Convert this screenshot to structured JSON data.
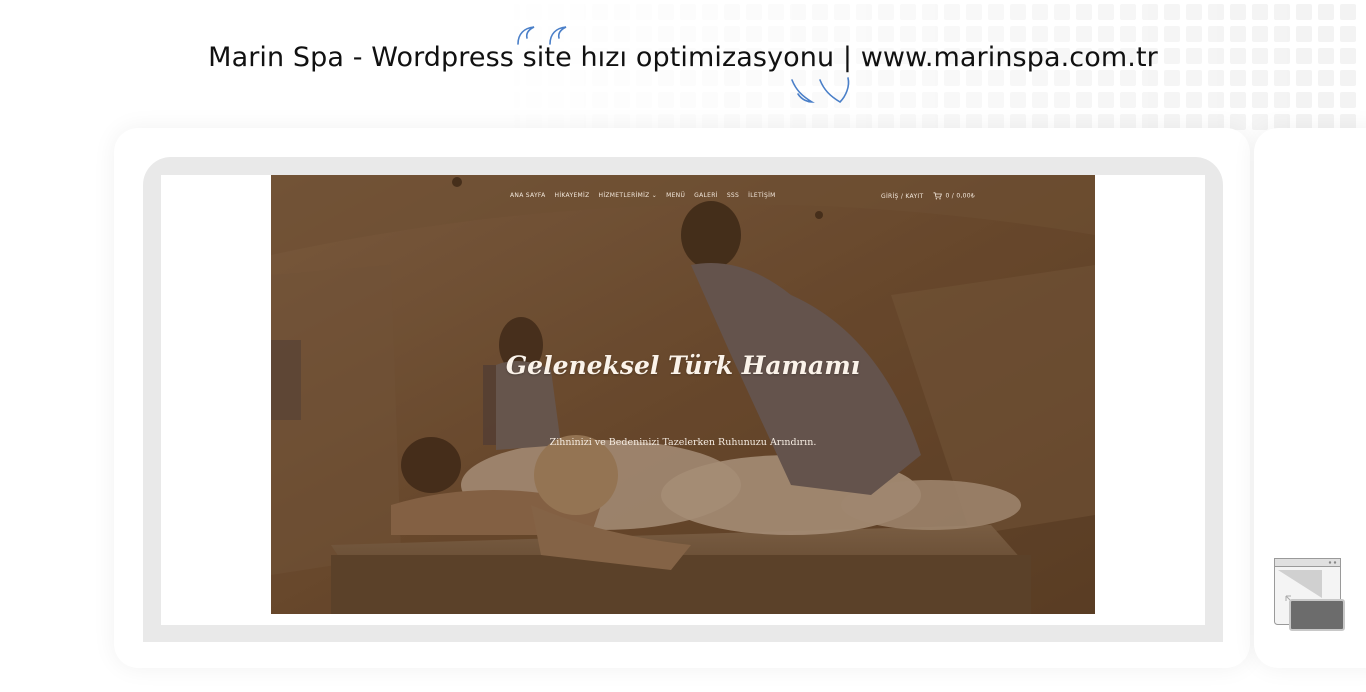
{
  "headline": {
    "text": "Marin Spa - Wordpress site hızı optimizasyonu | www.marinspa.com.tr"
  },
  "icons": {
    "quote_open": "quote-open-icon",
    "quote_close": "quote-close-icon",
    "cart": "cart-icon",
    "window_resize": "window-resize-icon"
  },
  "colors": {
    "quote_accent": "#4a7fc8",
    "hero_overlay": "#6e4e33",
    "nav_text": "#f3e8dc",
    "frame": "#e9e9e9"
  },
  "website": {
    "nav": {
      "items": [
        {
          "label": "ANA SAYFA"
        },
        {
          "label": "HİKAYEMİZ"
        },
        {
          "label": "HİZMETLERİMİZ ⌄"
        },
        {
          "label": "MENÜ"
        },
        {
          "label": "GALERİ"
        },
        {
          "label": "SSS"
        },
        {
          "label": "İLETİŞİM"
        }
      ],
      "login_label": "GİRİŞ / KAYIT",
      "cart_label": "0 / 0,00₺"
    },
    "hero": {
      "title": "Geleneksel Türk Hamamı",
      "subtitle": "Zihninizi ve Bedeninizi Tazelerken Ruhunuzu Arındırın."
    }
  }
}
